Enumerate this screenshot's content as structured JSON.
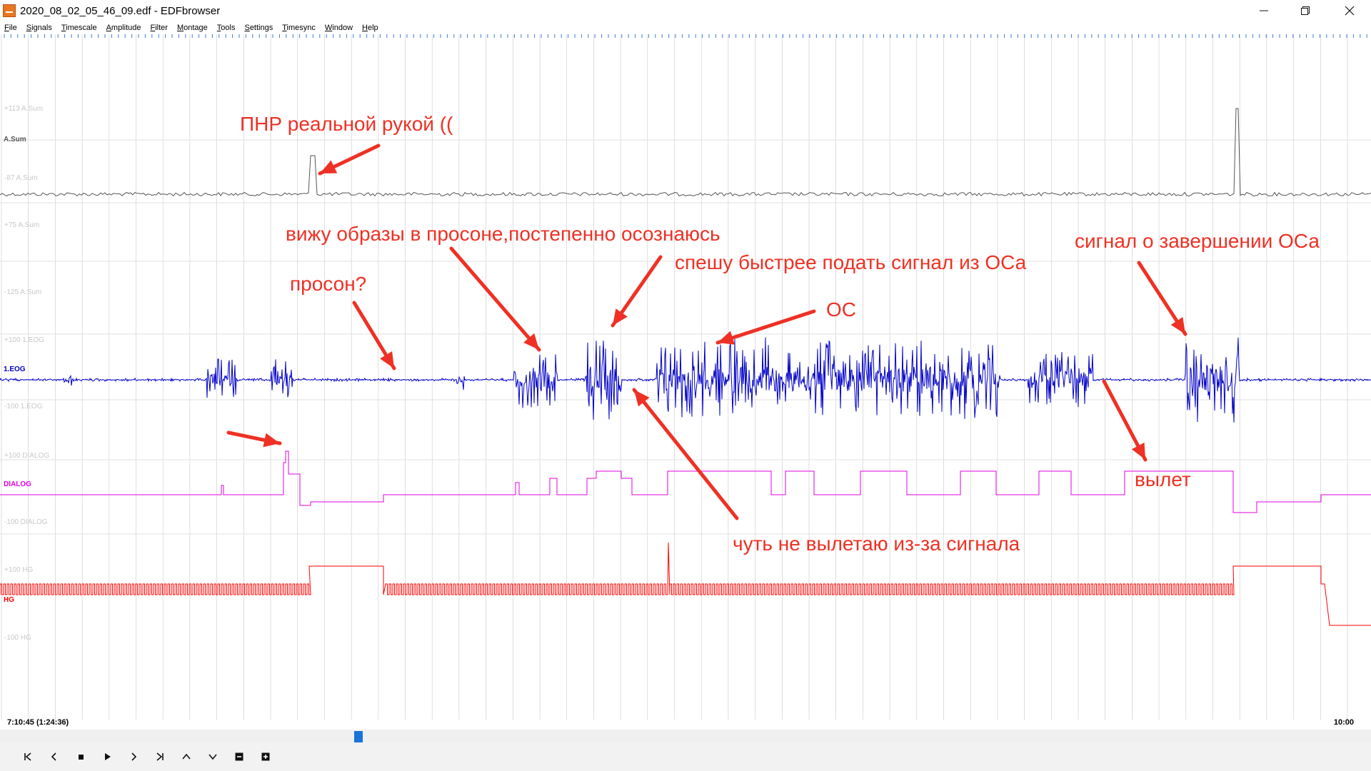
{
  "window": {
    "title": "2020_08_02_05_46_09.edf - EDFbrowser",
    "minimize_icon": "minimize-icon",
    "maximize_icon": "restore-icon",
    "close_icon": "close-icon"
  },
  "menu": [
    {
      "label": "File",
      "accel": "F",
      "rest": "ile"
    },
    {
      "label": "Signals",
      "accel": "S",
      "rest": "ignals"
    },
    {
      "label": "Timescale",
      "accel": "T",
      "rest": "imescale"
    },
    {
      "label": "Amplitude",
      "accel": "A",
      "rest": "mplitude"
    },
    {
      "label": "Filter",
      "accel": "F",
      "rest": "ilter"
    },
    {
      "label": "Montage",
      "accel": "M",
      "rest": "ontage"
    },
    {
      "label": "Tools",
      "accel": "T",
      "rest": "ools"
    },
    {
      "label": "Settings",
      "accel": "S",
      "rest": "ettings"
    },
    {
      "label": "Timesync",
      "accel": "T",
      "rest": "imesync"
    },
    {
      "label": "Window",
      "accel": "W",
      "rest": "indow"
    },
    {
      "label": "Help",
      "accel": "H",
      "rest": "elp"
    }
  ],
  "signals": [
    {
      "name": "A.Sum",
      "color": "#555555",
      "upper_label": "+113 A.Sum",
      "lower_label": "-87 A.Sum"
    },
    {
      "name": "1.EOG",
      "color": "#0000c8",
      "upper_label": "+100 1.EOG",
      "lower_label": "-100 1.EOG",
      "extra_upper": "+75 A.Sum",
      "extra_upper2": "-125 A.Sum"
    },
    {
      "name": "DIALOG",
      "color": "#e000e0",
      "upper_label": "+100 DIALOG",
      "lower_label": "-100 DIALOG"
    },
    {
      "name": "HG",
      "color": "#ff0000",
      "upper_label": "+100 HG",
      "lower_label": "-100 HG"
    }
  ],
  "annotations": {
    "pnr": "ПНР реальной рукой ((",
    "images": "вижу образы в просоне,постепенно осознаюсь",
    "hurry": "спешу быстрее подать сигнал из ОСа",
    "os": "ОС",
    "proson": "просон?",
    "end_signal": "сигнал о завершении ОСа",
    "vylet": "вылет",
    "almost": "чуть не вылетаю из-за сигнала"
  },
  "timeline": {
    "start": "7:10:45 (1:24:36)",
    "end": "10:00",
    "scroll_position": 0.264
  },
  "colors": {
    "annotation": "#ee3124",
    "grid": "#c8c8c8",
    "ruler": "#3a7bd5"
  },
  "nav_buttons": [
    {
      "name": "first-page-icon",
      "glyph": "K"
    },
    {
      "name": "page-back-icon",
      "glyph": "<"
    },
    {
      "name": "stop-icon",
      "glyph": "■"
    },
    {
      "name": "play-icon",
      "glyph": "▶"
    },
    {
      "name": "page-forward-icon",
      "glyph": ">"
    },
    {
      "name": "last-page-icon",
      "glyph": "▶|"
    },
    {
      "name": "amplitude-up-icon",
      "glyph": "^"
    },
    {
      "name": "amplitude-down-icon",
      "glyph": "v"
    },
    {
      "name": "zoom-out-icon",
      "glyph": "−"
    },
    {
      "name": "zoom-in-icon",
      "glyph": "+"
    }
  ]
}
